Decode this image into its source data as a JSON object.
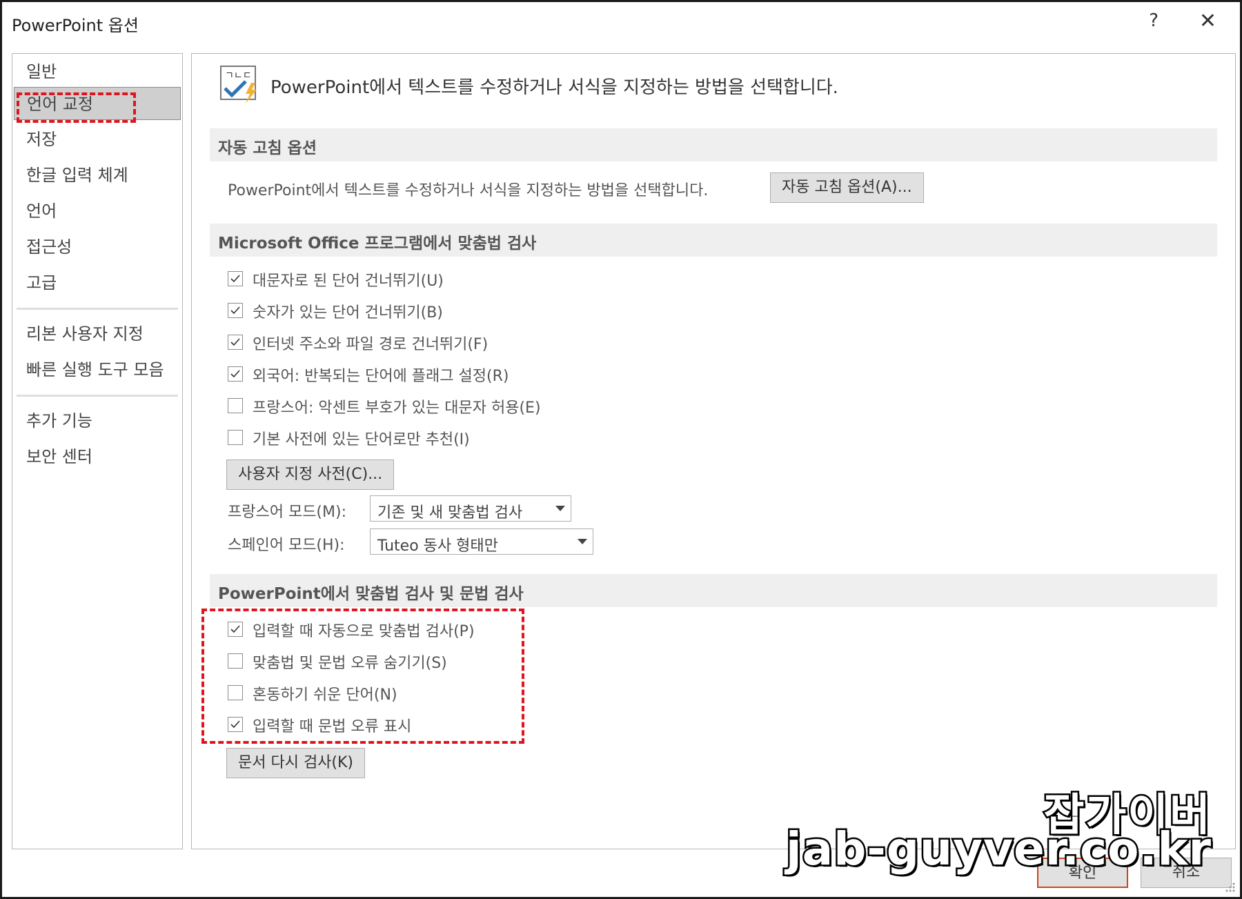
{
  "window": {
    "title": "PowerPoint 옵션",
    "help_label": "?",
    "close_label": "✕"
  },
  "sidebar": {
    "items": [
      {
        "label": "일반",
        "selected": false
      },
      {
        "label": "언어 교정",
        "selected": true
      },
      {
        "label": "저장",
        "selected": false
      },
      {
        "label": "한글 입력 체계",
        "selected": false
      },
      {
        "label": "언어",
        "selected": false
      },
      {
        "label": "접근성",
        "selected": false
      },
      {
        "label": "고급",
        "selected": false
      },
      {
        "label": "리본 사용자 지정",
        "selected": false
      },
      {
        "label": "빠른 실행 도구 모음",
        "selected": false
      },
      {
        "label": "추가 기능",
        "selected": false
      },
      {
        "label": "보안 센터",
        "selected": false
      }
    ]
  },
  "main": {
    "intro_icon_text": "ㄱㄴㄷ",
    "intro": "PowerPoint에서 텍스트를 수정하거나 서식을 지정하는 방법을 선택합니다.",
    "autocorrect": {
      "title": "자동 고침 옵션",
      "description": "PowerPoint에서 텍스트를 수정하거나 서식을 지정하는 방법을 선택합니다.",
      "button": "자동 고침 옵션(A)..."
    },
    "office_spelling": {
      "title": "Microsoft Office 프로그램에서 맞춤법 검사",
      "options": [
        {
          "label": "대문자로 된 단어 건너뛰기(U)",
          "checked": true
        },
        {
          "label": "숫자가 있는 단어 건너뛰기(B)",
          "checked": true
        },
        {
          "label": "인터넷 주소와 파일 경로 건너뛰기(F)",
          "checked": true
        },
        {
          "label": "외국어: 반복되는 단어에 플래그 설정(R)",
          "checked": true
        },
        {
          "label": "프랑스어: 악센트 부호가 있는 대문자 허용(E)",
          "checked": false
        },
        {
          "label": "기본 사전에 있는 단어로만 추천(I)",
          "checked": false
        }
      ],
      "custom_dict_button": "사용자 지정 사전(C)...",
      "french_mode_label": "프랑스어 모드(M):",
      "french_mode_value": "기존 및 새 맞춤법 검사",
      "spanish_mode_label": "스페인어 모드(H):",
      "spanish_mode_value": "Tuteo 동사 형태만"
    },
    "ppt_spelling": {
      "title": "PowerPoint에서 맞춤법 검사 및 문법 검사",
      "options": [
        {
          "label": "입력할 때 자동으로 맞춤법 검사(P)",
          "checked": true
        },
        {
          "label": "맞춤법 및 문법 오류 숨기기(S)",
          "checked": false
        },
        {
          "label": "혼동하기 쉬운 단어(N)",
          "checked": false
        },
        {
          "label": "입력할 때 문법 오류 표시",
          "checked": true
        }
      ],
      "recheck_button": "문서 다시 검사(K)"
    }
  },
  "footer": {
    "ok": "확인",
    "cancel": "취소"
  },
  "watermark": {
    "line1": "잡가이버",
    "line2": "jab-guyver.co.kr"
  },
  "colors": {
    "highlight": "#e0141e",
    "check": "#333333",
    "icon_check": "#2e75b6",
    "icon_bolt": "#f2b233"
  }
}
